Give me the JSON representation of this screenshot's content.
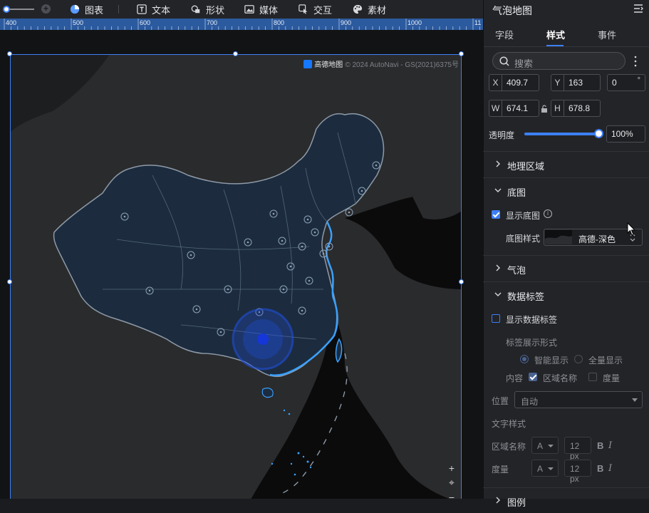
{
  "toolbar": {
    "items": [
      {
        "label": "图表",
        "icon": "pie-chart-icon"
      },
      {
        "label": "文本",
        "icon": "text-icon"
      },
      {
        "label": "形状",
        "icon": "shape-icon"
      },
      {
        "label": "媒体",
        "icon": "image-icon"
      },
      {
        "label": "交互",
        "icon": "interaction-icon"
      },
      {
        "label": "素材",
        "icon": "palette-icon"
      }
    ]
  },
  "ruler": {
    "labels": [
      "400",
      "500",
      "600",
      "700",
      "800",
      "900",
      "1000",
      "11"
    ]
  },
  "map": {
    "attribution_brand": "高德地图",
    "attribution_text": "© 2024 AutoNavi - GS(2021)6375号"
  },
  "panel": {
    "title": "气泡地图",
    "tabs": [
      "字段",
      "样式",
      "事件"
    ],
    "active_tab": "样式",
    "search_placeholder": "搜索",
    "position": {
      "x_label": "X",
      "x": "409.7",
      "y_label": "Y",
      "y": "163",
      "rotation": "0",
      "rotation_unit": "°"
    },
    "size": {
      "w_label": "W",
      "w": "674.1",
      "h_label": "H",
      "h": "678.8"
    },
    "opacity_label": "透明度",
    "opacity_value": "100%",
    "opacity_level": 1.0,
    "sections": {
      "geo_region": "地理区域",
      "basemap": "底图",
      "bubble": "气泡",
      "data_labels": "数据标签",
      "legend": "图例"
    },
    "basemap": {
      "show_label": "显示底图",
      "show_checked": true,
      "style_label": "底图样式",
      "style_value": "高德-深色"
    },
    "data_labels": {
      "show_label": "显示数据标签",
      "show_checked": false,
      "display_form_label": "标签展示形式",
      "smart_label": "智能显示",
      "all_label": "全量显示",
      "content_label": "内容",
      "region_name_label": "区域名称",
      "measure_label": "度量",
      "position_label": "位置",
      "position_value": "自动",
      "text_style_label": "文字样式",
      "region_name_row": "区域名称",
      "measure_row": "度量",
      "font_icon": "A",
      "font_size": "12 px",
      "bold": "B",
      "italic": "I"
    }
  },
  "colors": {
    "accent": "#3d7ff5",
    "panel_bg": "#232428",
    "canvas_bg": "#121315",
    "china_fill": "#1c2c3e",
    "china_stroke": "#8e9aa8",
    "bubble": "#1f4fd6"
  }
}
